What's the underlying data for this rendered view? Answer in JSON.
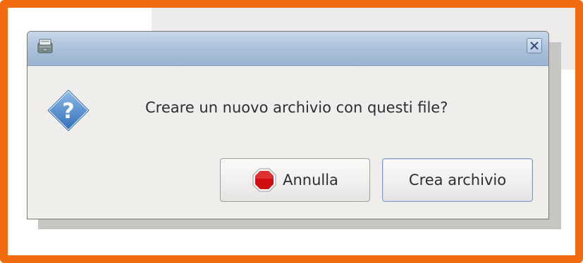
{
  "window": {
    "title": "",
    "app_icon": "archive-manager-icon",
    "close_icon": "close-icon"
  },
  "dialog": {
    "icon": "question-icon",
    "message": "Creare un nuovo archivio con questi file?"
  },
  "buttons": {
    "cancel_label": "Annulla",
    "cancel_icon": "stop-icon",
    "create_label": "Crea archivio"
  },
  "colors": {
    "frame_border": "#f26a0f",
    "titlebar": "#a9bfd9",
    "dialog_bg": "#f0eeeb",
    "question_icon_blue": "#3a78c2",
    "stop_icon_red": "#d01010"
  }
}
